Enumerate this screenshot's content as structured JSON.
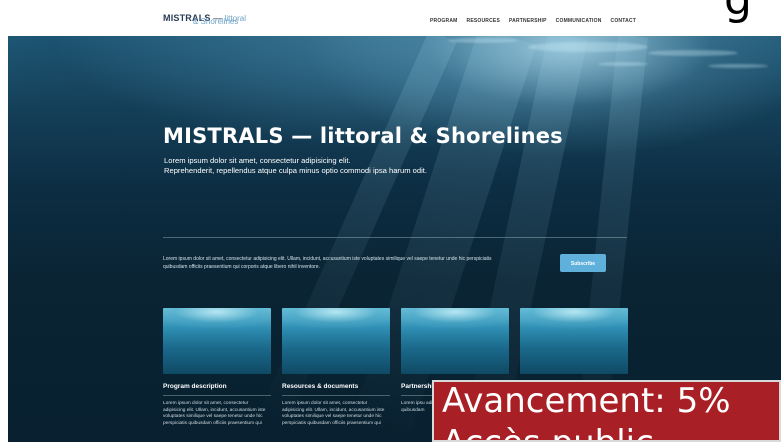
{
  "header": {
    "logo": {
      "main": "MISTRALS",
      "dash": " — ",
      "sub1": "littoral",
      "sub2": "& Shorelines"
    },
    "nav": [
      "PROGRAM",
      "RESOURCES",
      "PARTNERSHIP",
      "COMMUNICATION",
      "CONTACT"
    ],
    "corner_glyph": "g"
  },
  "hero": {
    "title": "MISTRALS — littoral & Shorelines",
    "subtitle_line1": "Lorem ipsum dolor sit amet, consectetur adipisicing elit.",
    "subtitle_line2": "Reprehenderit, repellendus atque culpa minus optio commodi ipsa harum odit.",
    "intro": "Lorem ipsum dolor sit amet, consectetur adipisicing elit. Ullam, incidunt, accusantium iste voluptates similique vel saepe tenetur unde hic perspiciatis quibusdam officiis praesentium qui corporis atque libero nihil inventore.",
    "subscribe_label": "Subscribe"
  },
  "cards": [
    {
      "title": "Program description",
      "text": "Lorem ipsum dolor sit amet, consectetur adipisicing elit. Ullam, incidunt, accusantium iste voluptates similique vel saepe tenetur unde hic perspiciatis quibusdam officiis praesentium qui"
    },
    {
      "title": "Resources & documents",
      "text": "Lorem ipsum dolor sit amet, consectetur adipisicing elit. Ullam, incidunt, accusantium iste voluptates similique vel saepe tenetur unde hic perspiciatis quibusdam officiis praesentium qui"
    },
    {
      "title": "Partnershi",
      "text": "Lorem ipsu adipisicing accusantiu saepe tenet quibusdam"
    },
    {
      "title": "",
      "text": ""
    }
  ],
  "overlay": {
    "line1": "Avancement: 5%",
    "line2": "Accès public"
  },
  "colors": {
    "accent": "#5fb0da",
    "overlay": "#a91f26",
    "logo": "#2a3a55",
    "logo_sub": "#6fa3c8"
  }
}
